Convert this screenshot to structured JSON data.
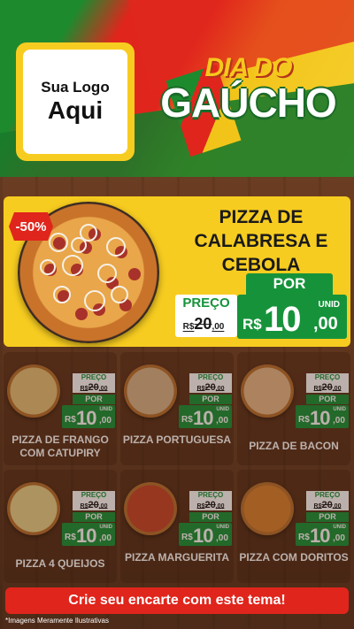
{
  "logo": {
    "line1": "Sua Logo",
    "line2": "Aqui"
  },
  "title": {
    "line1": "DIA DO",
    "line2": "GAÚCHO"
  },
  "featured": {
    "discount_badge": "-50%",
    "name": "PIZZA DE CALABRESA E CEBOLA",
    "preco_label": "PREÇO",
    "old_price": {
      "currency": "R$",
      "int": "20",
      "cents": ",00"
    },
    "por_label": "POR",
    "unid_label": "UNID",
    "new_price": {
      "currency": "R$",
      "int": "10",
      "cents": ",00"
    }
  },
  "products": [
    {
      "name": "PIZZA DE FRANGO COM CATUPIRY",
      "preco_label": "PREÇO",
      "old_currency": "R$",
      "old_int": "20",
      "old_cents": ",00",
      "por_label": "POR",
      "unid_label": "UNID",
      "currency": "R$",
      "int": "10",
      "cents": ",00",
      "color": "#e6c27a"
    },
    {
      "name": "PIZZA PORTUGUESA",
      "preco_label": "PREÇO",
      "old_currency": "R$",
      "old_int": "20",
      "old_cents": ",00",
      "por_label": "POR",
      "unid_label": "UNID",
      "currency": "R$",
      "int": "10",
      "cents": ",00",
      "color": "#d9b48a"
    },
    {
      "name": "PIZZA DE BACON",
      "preco_label": "PREÇO",
      "old_currency": "R$",
      "old_int": "20",
      "old_cents": ",00",
      "por_label": "POR",
      "unid_label": "UNID",
      "currency": "R$",
      "int": "10",
      "cents": ",00",
      "color": "#e8b98a"
    },
    {
      "name": "PIZZA 4 QUEIJOS",
      "preco_label": "PREÇO",
      "old_currency": "R$",
      "old_int": "20",
      "old_cents": ",00",
      "por_label": "POR",
      "unid_label": "UNID",
      "currency": "R$",
      "int": "10",
      "cents": ",00",
      "color": "#ead38a"
    },
    {
      "name": "PIZZA MARGUERITA",
      "preco_label": "PREÇO",
      "old_currency": "R$",
      "old_int": "20",
      "old_cents": ",00",
      "por_label": "POR",
      "unid_label": "UNID",
      "currency": "R$",
      "int": "10",
      "cents": ",00",
      "color": "#c8452a"
    },
    {
      "name": "PIZZA COM DORITOS",
      "preco_label": "PREÇO",
      "old_currency": "R$",
      "old_int": "20",
      "old_cents": ",00",
      "por_label": "POR",
      "unid_label": "UNID",
      "currency": "R$",
      "int": "10",
      "cents": ",00",
      "color": "#d9822e"
    }
  ],
  "cta": "Crie seu encarte com este tema!",
  "disclaimer": "*Imagens Meramente Ilustrativas",
  "colors": {
    "green": "#16933a",
    "red": "#e0251c",
    "yellow": "#f7cc20",
    "wood": "#5b331c"
  }
}
